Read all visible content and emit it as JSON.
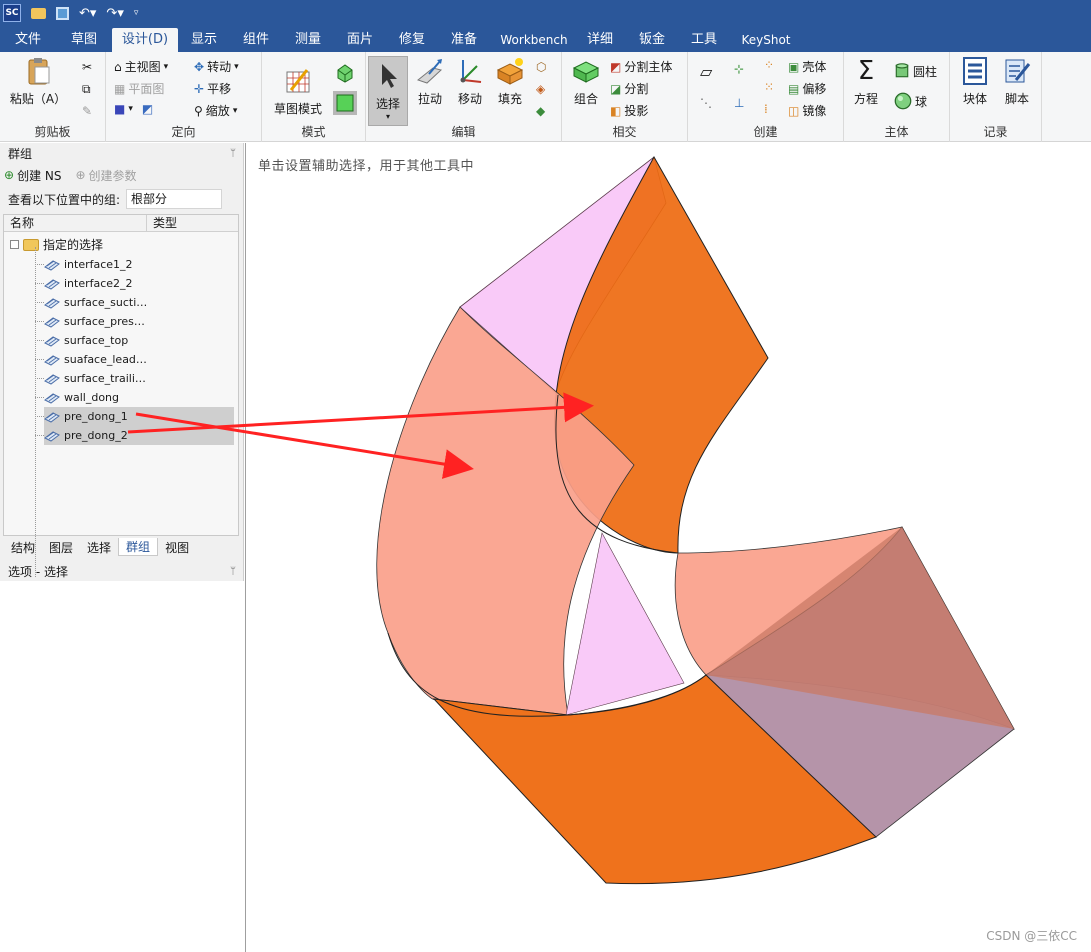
{
  "titlebar": {
    "logo_text": "SC",
    "quick_access": [
      "open-icon",
      "save-icon",
      "undo-icon",
      "redo-icon",
      "customize-icon"
    ]
  },
  "menu": {
    "tabs": [
      "文件",
      "草图",
      "设计(D)",
      "显示",
      "组件",
      "测量",
      "面片",
      "修复",
      "准备",
      "Workbench",
      "详细",
      "钣金",
      "工具",
      "KeyShot"
    ],
    "active": "设计(D)"
  },
  "ribbon": {
    "clipboard": {
      "label": "剪贴板",
      "paste": "粘贴（A）"
    },
    "orient": {
      "label": "定向",
      "home_view": "主视图",
      "plan_view": "平面图",
      "spin": "转动",
      "pan": "平移",
      "zoom": "缩放"
    },
    "mode": {
      "label": "模式",
      "sketch_mode": "草图模式"
    },
    "edit": {
      "label": "编辑",
      "select": "选择",
      "pull": "拉动",
      "move": "移动",
      "fill": "填充"
    },
    "intersect": {
      "label": "相交",
      "combine": "组合",
      "split_body": "分割主体",
      "split": "分割",
      "project": "投影"
    },
    "create": {
      "label": "创建",
      "shell": "壳体",
      "offset": "偏移",
      "mirror": "镜像"
    },
    "body": {
      "label": "主体",
      "equation": "方程",
      "cylinder": "圆柱",
      "sphere": "球"
    },
    "record": {
      "label": "记录",
      "block": "块体",
      "script": "脚本"
    }
  },
  "groups_panel": {
    "title": "群组",
    "create_ns": "创建 NS",
    "create_param": "创建参数",
    "location_label": "查看以下位置中的组:",
    "location_value": "根部分",
    "columns": [
      "名称",
      "类型"
    ],
    "root": "指定的选择",
    "items": [
      {
        "label": "interface1_2",
        "selected": false
      },
      {
        "label": "interface2_2",
        "selected": false
      },
      {
        "label": "surface_sucti…",
        "selected": false
      },
      {
        "label": "surface_pres…",
        "selected": false
      },
      {
        "label": "surface_top",
        "selected": false
      },
      {
        "label": "suaface_lead…",
        "selected": false
      },
      {
        "label": "surface_traili…",
        "selected": false
      },
      {
        "label": "wall_dong",
        "selected": false
      },
      {
        "label": "pre_dong_1",
        "selected": true
      },
      {
        "label": "pre_dong_2",
        "selected": true
      }
    ],
    "tabs": [
      "结构",
      "图层",
      "选择",
      "群组",
      "视图"
    ],
    "active_tab": "群组"
  },
  "options_panel": {
    "title": "选项 - 选择"
  },
  "viewport": {
    "hint": "单击设置辅助选择，用于其他工具中",
    "watermark": "CSDN @三依CC"
  },
  "colors": {
    "titlebar": "#2b579a",
    "orange_face": "#ee6a10",
    "salmon_face": "#fa9f8a",
    "pink_face": "#f9caf8",
    "purple_face": "#a8819a",
    "arrow": "#ff2222"
  }
}
